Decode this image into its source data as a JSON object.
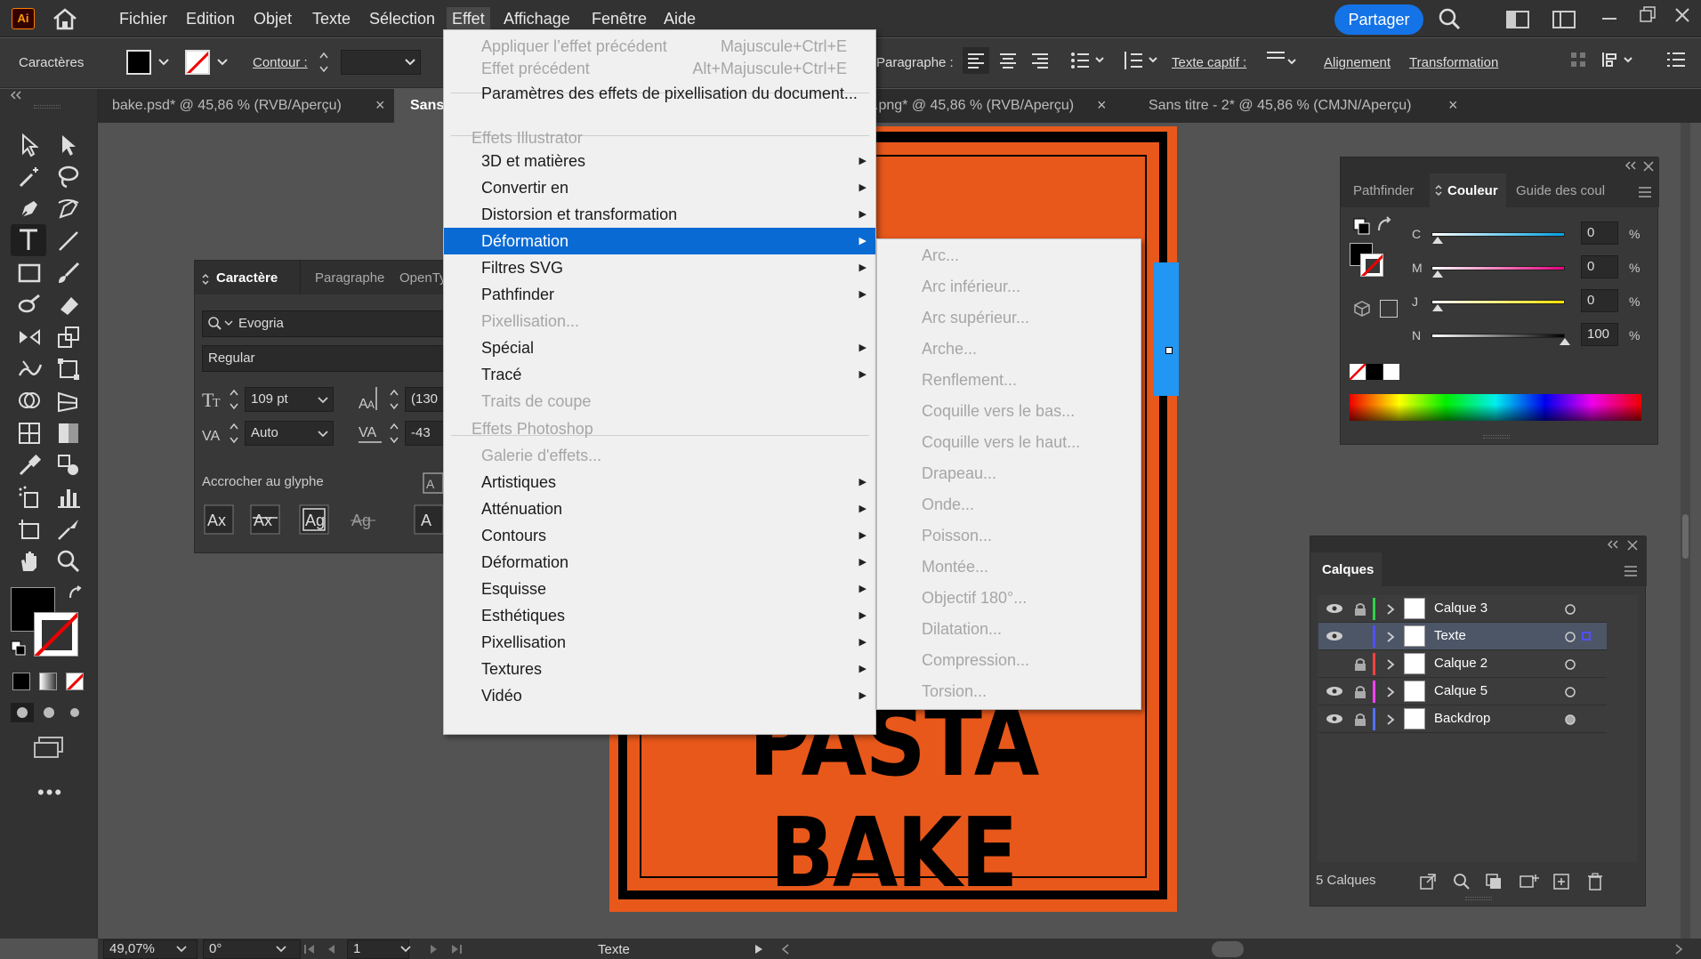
{
  "app": {
    "logo": "Ai"
  },
  "menubar": {
    "items": [
      "Fichier",
      "Edition",
      "Objet",
      "Texte",
      "Sélection",
      "Effet",
      "Affichage",
      "Fenêtre",
      "Aide"
    ],
    "share": "Partager"
  },
  "control": {
    "panel_label": "Caractères",
    "contour": "Contour :",
    "paragraph": "Paragraphe :",
    "wrap": "Texte captif :",
    "align": "Alignement",
    "transform": "Transformation"
  },
  "tabs": [
    {
      "label": "bake.psd* @ 45,86 % (RVB/Aperçu)"
    },
    {
      "label": "Sans"
    },
    {
      "label": ".png* @ 45,86 % (RVB/Aperçu)"
    },
    {
      "label": "Sans titre - 2* @ 45,86 % (CMJN/Aperçu)"
    }
  ],
  "char_panel": {
    "tabs": [
      "Caractère",
      "Paragraphe",
      "OpenTyp"
    ],
    "font": "Evogria",
    "style": "Regular",
    "size": "109 pt",
    "leading": "(130",
    "kerning": "Auto",
    "tracking": "-43",
    "snap": "Accrocher au glyphe"
  },
  "effect_menu": {
    "items": [
      {
        "label": "Appliquer l’effet précédent",
        "shortcut": "Majuscule+Ctrl+E",
        "state": "disabled"
      },
      {
        "label": "Effet précédent",
        "shortcut": "Alt+Majuscule+Ctrl+E",
        "state": "disabled"
      },
      {
        "label": "Paramètres des effets de pixellisation du document...",
        "state": "normal"
      },
      {
        "label": "Effets Illustrator",
        "state": "header"
      },
      {
        "label": "3D et matières",
        "state": "normal",
        "sub": true
      },
      {
        "label": "Convertir en",
        "state": "normal",
        "sub": true
      },
      {
        "label": "Distorsion et transformation",
        "state": "normal",
        "sub": true
      },
      {
        "label": "Déformation",
        "state": "selected",
        "sub": true
      },
      {
        "label": "Filtres SVG",
        "state": "normal",
        "sub": true
      },
      {
        "label": "Pathfinder",
        "state": "normal",
        "sub": true
      },
      {
        "label": "Pixellisation...",
        "state": "disabled"
      },
      {
        "label": "Spécial",
        "state": "normal",
        "sub": true
      },
      {
        "label": "Tracé",
        "state": "normal",
        "sub": true
      },
      {
        "label": "Traits de coupe",
        "state": "disabled"
      },
      {
        "label": "Effets Photoshop",
        "state": "header"
      },
      {
        "label": "Galerie d'effets...",
        "state": "disabled"
      },
      {
        "label": "Artistiques",
        "state": "normal",
        "sub": true
      },
      {
        "label": "Atténuation",
        "state": "normal",
        "sub": true
      },
      {
        "label": "Contours",
        "state": "normal",
        "sub": true
      },
      {
        "label": "Déformation",
        "state": "normal",
        "sub": true
      },
      {
        "label": "Esquisse",
        "state": "normal",
        "sub": true
      },
      {
        "label": "Esthétiques",
        "state": "normal",
        "sub": true
      },
      {
        "label": "Pixellisation",
        "state": "normal",
        "sub": true
      },
      {
        "label": "Textures",
        "state": "normal",
        "sub": true
      },
      {
        "label": "Vidéo",
        "state": "normal",
        "sub": true
      }
    ]
  },
  "warp_submenu": [
    "Arc...",
    "Arc inférieur...",
    "Arc supérieur...",
    "Arche...",
    "Renflement...",
    "Coquille vers le bas...",
    "Coquille vers le haut...",
    "Drapeau...",
    "Onde...",
    "Poisson...",
    "Montée...",
    "Objectif 180°...",
    "Dilatation...",
    "Compression...",
    "Torsion..."
  ],
  "artboard": {
    "text": "PASTA BAKE",
    "bg": "#e8581b"
  },
  "color_panel": {
    "tabs": [
      "Pathfinder",
      "Couleur",
      "Guide des coul"
    ],
    "channels": [
      {
        "label": "C",
        "value": "0"
      },
      {
        "label": "M",
        "value": "0"
      },
      {
        "label": "J",
        "value": "0"
      },
      {
        "label": "N",
        "value": "100"
      }
    ],
    "percent": "%"
  },
  "layers_panel": {
    "title": "Calques",
    "layers": [
      {
        "name": "Calque 3",
        "color": "#2fd24a",
        "visible": true
      },
      {
        "name": "Texte",
        "color": "#5050ff",
        "visible": true
      },
      {
        "name": "Calque 2",
        "color": "#ff4040",
        "visible": false
      },
      {
        "name": "Calque 5",
        "color": "#ff40ff",
        "visible": true
      },
      {
        "name": "Backdrop",
        "color": "#5070ff",
        "visible": true
      }
    ],
    "count": "5 Calques"
  },
  "status": {
    "zoom": "49,07%",
    "rotation": "0°",
    "page": "1",
    "tool": "Texte"
  }
}
